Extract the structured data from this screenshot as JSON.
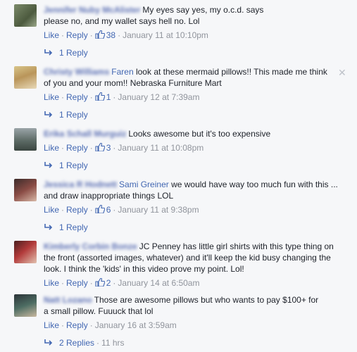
{
  "actions": {
    "like": "Like",
    "reply": "Reply",
    "sep": "·"
  },
  "comments": [
    {
      "author": "Jennifer Nuby McAlister",
      "mention": "",
      "text": "My eyes say yes, my o.c.d. says please no, and my wallet says hell no. Lol",
      "likes": "38",
      "time": "January 11 at 10:10pm",
      "replies": "1 Reply",
      "reply_meta": ""
    },
    {
      "author": "Christy Williams",
      "mention": "Faren",
      "text": "look at these mermaid pillows!! This made me think of you and your mom!! Nebraska Furniture Mart",
      "likes": "1",
      "time": "January 12 at 7:39am",
      "replies": "1 Reply",
      "reply_meta": ""
    },
    {
      "author": "Erika Schall Murguiz",
      "mention": "",
      "text": "Looks awesome but it's too expensive",
      "likes": "3",
      "time": "January 11 at 10:08pm",
      "replies": "1 Reply",
      "reply_meta": ""
    },
    {
      "author": "Jessica R Hodnett",
      "mention": "Sami Greiner",
      "text": "we would have way too much fun with this ... and draw inappropriate things LOL",
      "likes": "6",
      "time": "January 11 at 9:38pm",
      "replies": "1 Reply",
      "reply_meta": ""
    },
    {
      "author": "Kimberly Corbin Bonze",
      "mention": "",
      "text": "JC Penney has little girl shirts with this type thing on the front (assorted images, whatever) and it'll keep the kid busy changing the look. I think the 'kids' in this video prove my point. Lol!",
      "likes": "2",
      "time": "January 14 at 6:50am",
      "replies": "",
      "reply_meta": ""
    },
    {
      "author": "Natt Lozano",
      "mention": "",
      "text": "Those are awesome pillows but who wants to pay $100+ for a small pillow. Fuuuck that lol",
      "likes": "",
      "time": "January 16 at 3:59am",
      "replies": "2 Replies",
      "reply_meta": "11 hrs"
    }
  ],
  "close_glyph": "✕"
}
